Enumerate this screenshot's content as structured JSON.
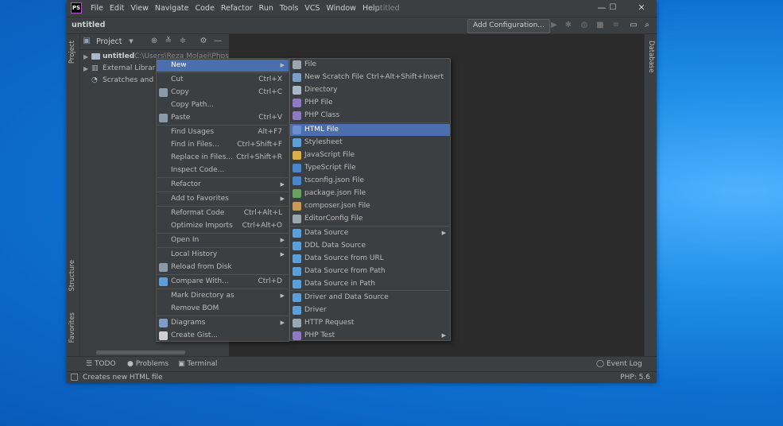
{
  "window": {
    "title": "untitled",
    "app_logo": "PS",
    "controls": [
      "—",
      "☐",
      "✕"
    ]
  },
  "menubar": [
    "File",
    "Edit",
    "View",
    "Navigate",
    "Code",
    "Refactor",
    "Run",
    "Tools",
    "VCS",
    "Window",
    "Help"
  ],
  "navbar": {
    "breadcrumb": "untitled",
    "add_config": "Add Configuration..."
  },
  "project": {
    "header": "Project",
    "tree": [
      {
        "name": "untitled",
        "path": "C:\\Users\\Reza Molaei\\Phpstor"
      },
      {
        "name": "External Librarie"
      },
      {
        "name": "Scratches and C"
      }
    ]
  },
  "side_tabs": {
    "left_top": "Project",
    "left_structure": "Structure",
    "left_favorites": "Favorites",
    "right": "Database"
  },
  "context_menu": [
    {
      "label": "New",
      "sub": true,
      "selected": true
    },
    {
      "label": "Cut",
      "shortcut": "Ctrl+X",
      "icon": "scissors-icon"
    },
    {
      "label": "Copy",
      "shortcut": "Ctrl+C",
      "icon": "copy-icon"
    },
    {
      "label": "Copy Path..."
    },
    {
      "label": "Paste",
      "shortcut": "Ctrl+V",
      "icon": "paste-icon"
    },
    {
      "label": "Find Usages",
      "shortcut": "Alt+F7"
    },
    {
      "label": "Find in Files...",
      "shortcut": "Ctrl+Shift+F"
    },
    {
      "label": "Replace in Files...",
      "shortcut": "Ctrl+Shift+R"
    },
    {
      "label": "Inspect Code..."
    },
    {
      "label": "Refactor",
      "sub": true
    },
    {
      "label": "Add to Favorites",
      "sub": true
    },
    {
      "label": "Reformat Code",
      "shortcut": "Ctrl+Alt+L"
    },
    {
      "label": "Optimize Imports",
      "shortcut": "Ctrl+Alt+O"
    },
    {
      "label": "Open In",
      "sub": true
    },
    {
      "label": "Local History",
      "sub": true
    },
    {
      "label": "Reload from Disk",
      "icon": "reload-icon"
    },
    {
      "label": "Compare With...",
      "shortcut": "Ctrl+D",
      "icon": "compare-icon"
    },
    {
      "label": "Mark Directory as",
      "sub": true
    },
    {
      "label": "Remove BOM"
    },
    {
      "label": "Diagrams",
      "sub": true,
      "icon": "diagram-icon"
    },
    {
      "label": "Create Gist...",
      "icon": "github-icon"
    }
  ],
  "new_submenu": [
    {
      "label": "File",
      "icon": "file-icon"
    },
    {
      "label": "New Scratch File",
      "shortcut": "Ctrl+Alt+Shift+Insert",
      "icon": "scratch-icon"
    },
    {
      "label": "Directory",
      "icon": "folder-icon"
    },
    {
      "label": "PHP File",
      "icon": "php-file-icon"
    },
    {
      "label": "PHP Class",
      "icon": "php-class-icon"
    },
    {
      "label": "HTML File",
      "icon": "html-file-icon",
      "selected": true
    },
    {
      "label": "Stylesheet",
      "icon": "css-icon"
    },
    {
      "label": "JavaScript File",
      "icon": "js-icon"
    },
    {
      "label": "TypeScript File",
      "icon": "ts-icon"
    },
    {
      "label": "tsconfig.json File",
      "icon": "tsconfig-icon"
    },
    {
      "label": "package.json File",
      "icon": "npm-icon"
    },
    {
      "label": "composer.json File",
      "icon": "composer-icon"
    },
    {
      "label": "EditorConfig File",
      "icon": "gear-icon"
    },
    {
      "label": "Data Source",
      "sub": true,
      "icon": "database-icon"
    },
    {
      "label": "DDL Data Source",
      "icon": "ddl-icon"
    },
    {
      "label": "Data Source from URL",
      "icon": "database-url-icon"
    },
    {
      "label": "Data Source from Path",
      "icon": "database-path-icon"
    },
    {
      "label": "Data Source in Path",
      "icon": "database-in-path-icon"
    },
    {
      "label": "Driver and Data Source",
      "icon": "driver-datasource-icon"
    },
    {
      "label": "Driver",
      "icon": "driver-icon"
    },
    {
      "label": "HTTP Request",
      "icon": "http-icon"
    },
    {
      "label": "PHP Test",
      "sub": true,
      "icon": "php-test-icon"
    }
  ],
  "bottom_tabs": [
    "TODO",
    "Problems",
    "Terminal"
  ],
  "event_log": "Event Log",
  "status": {
    "message": "Creates new HTML file",
    "php_version": "PHP: 5.6"
  },
  "colors": {
    "selection": "#4b6eaf",
    "panel": "#3c3f41",
    "editor": "#2b2b2b",
    "desktop": "#1f8fe8"
  }
}
